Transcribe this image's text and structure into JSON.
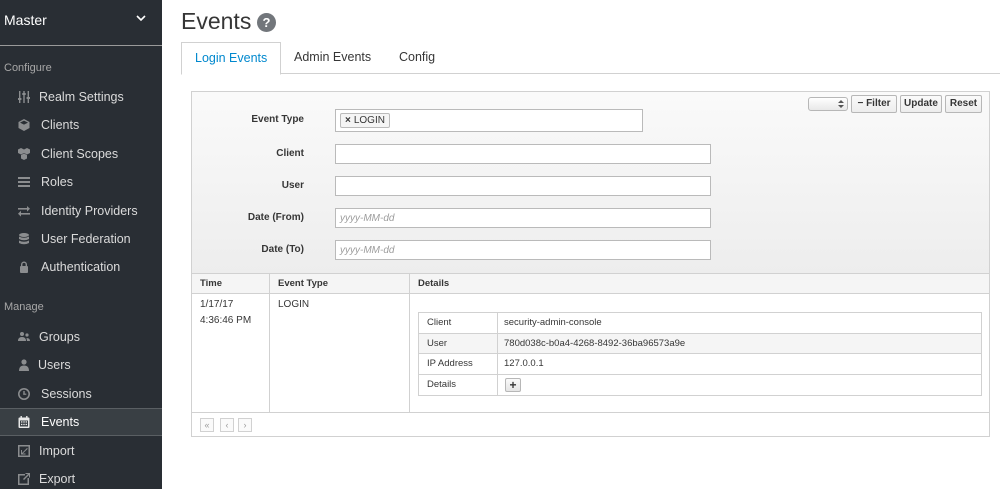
{
  "sidebar": {
    "realm": "Master",
    "configure_title": "Configure",
    "manage_title": "Manage",
    "configure_items": [
      {
        "label": "Realm Settings",
        "icon": "sliders-icon"
      },
      {
        "label": "Clients",
        "icon": "cube-icon"
      },
      {
        "label": "Client Scopes",
        "icon": "cubes-icon"
      },
      {
        "label": "Roles",
        "icon": "list-icon"
      },
      {
        "label": "Identity Providers",
        "icon": "exchange-icon"
      },
      {
        "label": "User Federation",
        "icon": "database-icon"
      },
      {
        "label": "Authentication",
        "icon": "lock-icon"
      }
    ],
    "manage_items": [
      {
        "label": "Groups",
        "icon": "users-icon"
      },
      {
        "label": "Users",
        "icon": "user-icon"
      },
      {
        "label": "Sessions",
        "icon": "clock-icon"
      },
      {
        "label": "Events",
        "icon": "calendar-icon",
        "active": true
      },
      {
        "label": "Import",
        "icon": "import-icon"
      },
      {
        "label": "Export",
        "icon": "export-icon"
      }
    ]
  },
  "header": {
    "title": "Events",
    "help": "?"
  },
  "tabs": [
    {
      "label": "Login Events",
      "active": true
    },
    {
      "label": "Admin Events"
    },
    {
      "label": "Config"
    }
  ],
  "toolbar": {
    "filter_label": "Filter",
    "filter_icon": "−",
    "update_label": "Update",
    "reset_label": "Reset"
  },
  "filters": {
    "event_type_label": "Event Type",
    "event_type_tag": "LOGIN",
    "client_label": "Client",
    "user_label": "User",
    "date_from_label": "Date (From)",
    "date_from_placeholder": "yyyy-MM-dd",
    "date_to_label": "Date (To)",
    "date_to_placeholder": "yyyy-MM-dd"
  },
  "table": {
    "columns": [
      "Time",
      "Event Type",
      "Details"
    ],
    "rows": [
      {
        "time_date": "1/17/17",
        "time_clock": "4:36:46 PM",
        "event_type": "LOGIN",
        "details": [
          {
            "key": "Client",
            "value": "security-admin-console"
          },
          {
            "key": "User",
            "value": "780d038c-b0a4-4268-8492-36ba96573a9e"
          },
          {
            "key": "IP Address",
            "value": "127.0.0.1"
          },
          {
            "key": "Details",
            "value": "+"
          }
        ]
      }
    ]
  },
  "pager": {
    "first": "«",
    "prev": "‹",
    "next": "›"
  }
}
